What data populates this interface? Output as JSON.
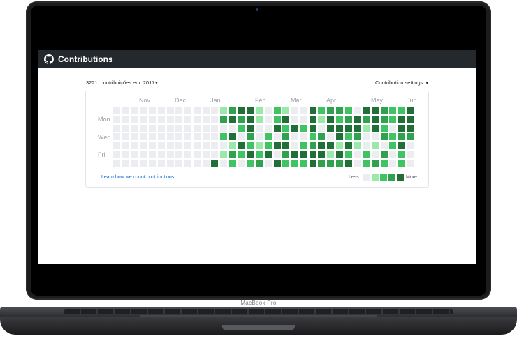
{
  "device": {
    "brand": "MacBook Pro"
  },
  "app": {
    "title": "Contributions",
    "logo_icon": "github-octocat-icon"
  },
  "summary": {
    "count": "3221",
    "text": "contribuições em",
    "year": "2017"
  },
  "settings": {
    "label": "Contribution settings"
  },
  "months": [
    "Nov",
    "Dec",
    "Jan",
    "Feb",
    "Mar",
    "Apr",
    "May",
    "Jun"
  ],
  "day_labels": [
    "Mon",
    "Wed",
    "Fri"
  ],
  "footer": {
    "link": "Learn how we count contributions.",
    "less": "Less",
    "more": "More"
  },
  "colors": {
    "level0": "#ebedf0",
    "level1": "#9be9a8",
    "level2": "#40c463",
    "level3": "#30a14e",
    "level4": "#216e39",
    "link": "#0366d6",
    "appbar": "#24292e"
  },
  "calendar": {
    "weeks": [
      [
        0,
        0,
        0,
        0,
        0,
        0,
        0
      ],
      [
        0,
        0,
        0,
        0,
        0,
        0,
        0
      ],
      [
        0,
        0,
        0,
        0,
        0,
        0,
        0
      ],
      [
        0,
        0,
        0,
        0,
        0,
        0,
        0
      ],
      [
        0,
        0,
        0,
        0,
        0,
        0,
        0
      ],
      [
        0,
        0,
        0,
        0,
        0,
        0,
        0
      ],
      [
        0,
        0,
        0,
        0,
        0,
        0,
        0
      ],
      [
        0,
        0,
        0,
        0,
        0,
        0,
        0
      ],
      [
        0,
        0,
        0,
        0,
        0,
        0,
        0
      ],
      [
        0,
        0,
        0,
        0,
        0,
        0,
        0
      ],
      [
        0,
        0,
        0,
        0,
        0,
        0,
        0
      ],
      [
        0,
        0,
        0,
        0,
        0,
        0,
        4
      ],
      [
        1,
        3,
        0,
        2,
        0,
        1,
        0
      ],
      [
        3,
        4,
        0,
        4,
        1,
        3,
        2
      ],
      [
        4,
        3,
        2,
        0,
        4,
        2,
        0
      ],
      [
        4,
        4,
        4,
        3,
        2,
        4,
        2
      ],
      [
        1,
        1,
        0,
        0,
        1,
        2,
        3
      ],
      [
        0,
        0,
        0,
        2,
        2,
        4,
        0
      ],
      [
        2,
        2,
        4,
        0,
        4,
        0,
        4
      ],
      [
        1,
        4,
        2,
        3,
        4,
        3,
        2
      ],
      [
        0,
        0,
        4,
        0,
        0,
        4,
        2
      ],
      [
        0,
        0,
        2,
        0,
        2,
        4,
        2
      ],
      [
        4,
        4,
        4,
        2,
        3,
        4,
        4
      ],
      [
        2,
        1,
        0,
        3,
        4,
        4,
        3
      ],
      [
        3,
        4,
        4,
        0,
        4,
        1,
        3
      ],
      [
        3,
        2,
        4,
        4,
        1,
        4,
        3
      ],
      [
        2,
        3,
        4,
        2,
        4,
        2,
        4
      ],
      [
        0,
        4,
        4,
        3,
        1,
        0,
        0
      ],
      [
        4,
        3,
        1,
        0,
        0,
        2,
        2
      ],
      [
        4,
        4,
        4,
        0,
        1,
        0,
        3
      ],
      [
        3,
        3,
        2,
        3,
        0,
        3,
        2
      ],
      [
        2,
        2,
        0,
        2,
        2,
        0,
        0
      ],
      [
        2,
        4,
        4,
        3,
        4,
        2,
        2
      ],
      [
        4,
        4,
        4,
        3,
        0,
        0,
        0
      ]
    ]
  }
}
